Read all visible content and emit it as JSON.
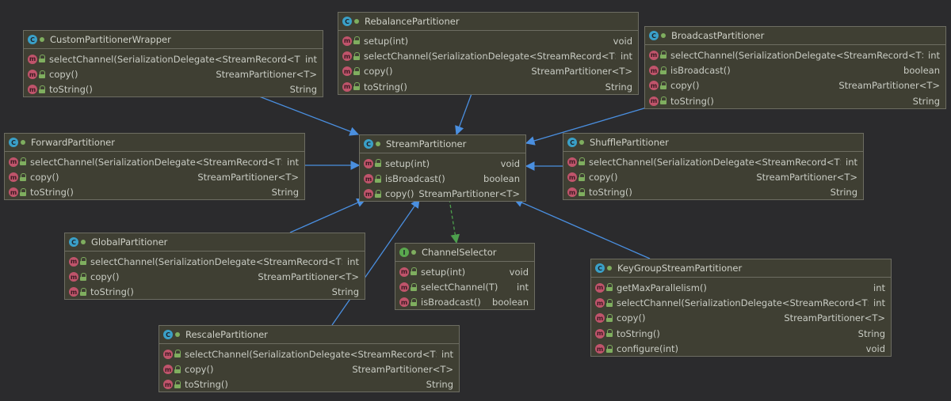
{
  "colors": {
    "inheritance_arrow": "#4a8fe0",
    "realization_arrow": "#4da04d",
    "box_bg": "#3f3f33",
    "box_border": "#6d6d62"
  },
  "icons": {
    "class": "class-icon",
    "interface": "interface-icon",
    "method": "method-icon",
    "public": "lock-icon"
  },
  "classes": [
    {
      "id": "custom",
      "kind": "C",
      "name": "CustomPartitionerWrapper",
      "members": [
        {
          "sig": "selectChannel(SerializationDelegate<StreamRecord<T>>)",
          "ret": "int"
        },
        {
          "sig": "copy()",
          "ret": "StreamPartitioner<T>"
        },
        {
          "sig": "toString()",
          "ret": "String"
        }
      ]
    },
    {
      "id": "rebalance",
      "kind": "C",
      "name": "RebalancePartitioner",
      "members": [
        {
          "sig": "setup(int)",
          "ret": "void"
        },
        {
          "sig": "selectChannel(SerializationDelegate<StreamRecord<T>>)",
          "ret": "int"
        },
        {
          "sig": "copy()",
          "ret": "StreamPartitioner<T>"
        },
        {
          "sig": "toString()",
          "ret": "String"
        }
      ]
    },
    {
      "id": "broadcast",
      "kind": "C",
      "name": "BroadcastPartitioner",
      "members": [
        {
          "sig": "selectChannel(SerializationDelegate<StreamRecord<T>>)",
          "ret": "int"
        },
        {
          "sig": "isBroadcast()",
          "ret": "boolean"
        },
        {
          "sig": "copy()",
          "ret": "StreamPartitioner<T>"
        },
        {
          "sig": "toString()",
          "ret": "String"
        }
      ]
    },
    {
      "id": "forward",
      "kind": "C",
      "name": "ForwardPartitioner",
      "members": [
        {
          "sig": "selectChannel(SerializationDelegate<StreamRecord<T>>)",
          "ret": "int"
        },
        {
          "sig": "copy()",
          "ret": "StreamPartitioner<T>"
        },
        {
          "sig": "toString()",
          "ret": "String"
        }
      ]
    },
    {
      "id": "stream",
      "kind": "C",
      "name": "StreamPartitioner",
      "members": [
        {
          "sig": "setup(int)",
          "ret": "void"
        },
        {
          "sig": "isBroadcast()",
          "ret": "boolean"
        },
        {
          "sig": "copy()",
          "ret": "StreamPartitioner<T>"
        }
      ]
    },
    {
      "id": "shuffle",
      "kind": "C",
      "name": "ShufflePartitioner",
      "members": [
        {
          "sig": "selectChannel(SerializationDelegate<StreamRecord<T>>)",
          "ret": "int"
        },
        {
          "sig": "copy()",
          "ret": "StreamPartitioner<T>"
        },
        {
          "sig": "toString()",
          "ret": "String"
        }
      ]
    },
    {
      "id": "global",
      "kind": "C",
      "name": "GlobalPartitioner",
      "members": [
        {
          "sig": "selectChannel(SerializationDelegate<StreamRecord<T>>)",
          "ret": "int"
        },
        {
          "sig": "copy()",
          "ret": "StreamPartitioner<T>"
        },
        {
          "sig": "toString()",
          "ret": "String"
        }
      ]
    },
    {
      "id": "selector",
      "kind": "I",
      "name": "ChannelSelector",
      "members": [
        {
          "sig": "setup(int)",
          "ret": "void"
        },
        {
          "sig": "selectChannel(T)",
          "ret": "int"
        },
        {
          "sig": "isBroadcast()",
          "ret": "boolean"
        }
      ]
    },
    {
      "id": "keygroup",
      "kind": "C",
      "name": "KeyGroupStreamPartitioner",
      "members": [
        {
          "sig": "getMaxParallelism()",
          "ret": "int"
        },
        {
          "sig": "selectChannel(SerializationDelegate<StreamRecord<T>>)",
          "ret": "int"
        },
        {
          "sig": "copy()",
          "ret": "StreamPartitioner<T>"
        },
        {
          "sig": "toString()",
          "ret": "String"
        },
        {
          "sig": "configure(int)",
          "ret": "void"
        }
      ]
    },
    {
      "id": "rescale",
      "kind": "C",
      "name": "RescalePartitioner",
      "members": [
        {
          "sig": "selectChannel(SerializationDelegate<StreamRecord<T>>)",
          "ret": "int"
        },
        {
          "sig": "copy()",
          "ret": "StreamPartitioner<T>"
        },
        {
          "sig": "toString()",
          "ret": "String"
        }
      ]
    }
  ],
  "relations": [
    {
      "from": "custom",
      "to": "stream",
      "type": "extends"
    },
    {
      "from": "rebalance",
      "to": "stream",
      "type": "extends"
    },
    {
      "from": "broadcast",
      "to": "stream",
      "type": "extends"
    },
    {
      "from": "forward",
      "to": "stream",
      "type": "extends"
    },
    {
      "from": "shuffle",
      "to": "stream",
      "type": "extends"
    },
    {
      "from": "global",
      "to": "stream",
      "type": "extends"
    },
    {
      "from": "rescale",
      "to": "stream",
      "type": "extends"
    },
    {
      "from": "keygroup",
      "to": "stream",
      "type": "extends"
    },
    {
      "from": "stream",
      "to": "selector",
      "type": "implements"
    }
  ]
}
